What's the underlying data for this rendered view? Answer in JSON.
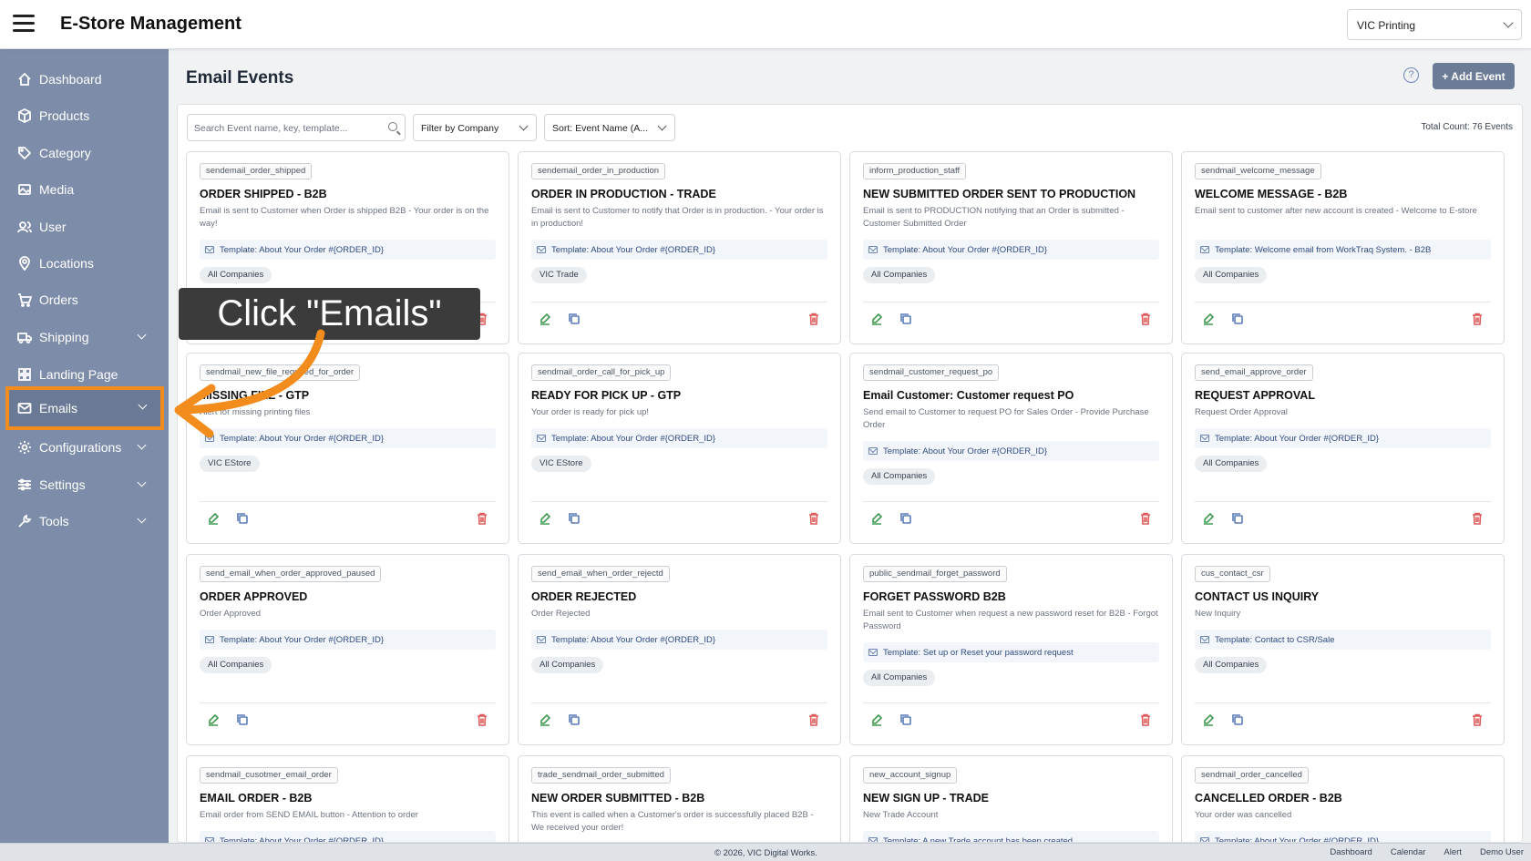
{
  "header": {
    "title": "E-Store Management",
    "company_value": "VIC Printing"
  },
  "sidebar": {
    "items": [
      {
        "label": "Dashboard",
        "icon": "home-icon"
      },
      {
        "label": "Products",
        "icon": "box-icon"
      },
      {
        "label": "Category",
        "icon": "tag-icon"
      },
      {
        "label": "Media",
        "icon": "image-icon"
      },
      {
        "label": "User",
        "icon": "users-icon"
      },
      {
        "label": "Locations",
        "icon": "map-pin-icon"
      },
      {
        "label": "Orders",
        "icon": "cart-icon"
      },
      {
        "label": "Shipping",
        "icon": "truck-icon"
      },
      {
        "label": "Landing Page",
        "icon": "layout-icon"
      },
      {
        "label": "Emails",
        "icon": "mail-icon"
      },
      {
        "label": "Configurations",
        "icon": "gear-icon"
      },
      {
        "label": "Settings",
        "icon": "sliders-icon"
      },
      {
        "label": "Tools",
        "icon": "wrench-icon"
      }
    ]
  },
  "main": {
    "title": "Email Events",
    "add_label": "+ Add Event",
    "search_placeholder": "Search Event name, key, template...",
    "filter_company": "Filter by Company",
    "sort_label": "Sort: Event Name (A...",
    "total_count": "Total Count: 76 Events"
  },
  "cards": [
    {
      "key": "sendemail_order_shipped",
      "title": "ORDER SHIPPED - B2B",
      "desc": "Email is sent to Customer when Order is shipped B2B - Your order is on the way!",
      "template": "Template: About Your Order #{ORDER_ID}",
      "company": "All Companies"
    },
    {
      "key": "sendemail_order_in_production",
      "title": "ORDER IN PRODUCTION - TRADE",
      "desc": "Email is sent to Customer to notify that Order is in production. - Your order is in production!",
      "template": "Template: About Your Order #{ORDER_ID}",
      "company": "VIC Trade"
    },
    {
      "key": "inform_production_staff",
      "title": "NEW SUBMITTED ORDER SENT TO PRODUCTION",
      "desc": "Email is sent to PRODUCTION notifying that an Order is submitted - Customer Submitted Order",
      "template": "Template: About Your Order #{ORDER_ID}",
      "company": "All Companies"
    },
    {
      "key": "sendmail_welcome_message",
      "title": "WELCOME MESSAGE - B2B",
      "desc": "Email sent to customer after new account is created - Welcome to E-store",
      "template": "Template: Welcome email from WorkTraq System. - B2B",
      "company": "All Companies"
    },
    {
      "key": "sendmail_new_file_required_for_order",
      "title": "MISSING FILE - GTP",
      "desc": "Alert for missing printing files",
      "template": "Template: About Your Order #{ORDER_ID}",
      "company": "VIC EStore"
    },
    {
      "key": "sendmail_order_call_for_pick_up",
      "title": "READY FOR PICK UP - GTP",
      "desc": "Your order is ready for pick up!",
      "template": "Template: About Your Order #{ORDER_ID}",
      "company": "VIC EStore"
    },
    {
      "key": "sendmail_customer_request_po",
      "title": "Email Customer: Customer request PO",
      "desc": "Send email to Customer to request PO for Sales Order - Provide Purchase Order",
      "template": "Template: About Your Order #{ORDER_ID}",
      "company": "All Companies"
    },
    {
      "key": "send_email_approve_order",
      "title": "REQUEST APPROVAL",
      "desc": "Request Order Approval",
      "template": "Template: About Your Order #{ORDER_ID}",
      "company": "All Companies"
    },
    {
      "key": "send_email_when_order_approved_paused",
      "title": "ORDER APPROVED",
      "desc": "Order Approved",
      "template": "Template: About Your Order #{ORDER_ID}",
      "company": "All Companies"
    },
    {
      "key": "send_email_when_order_rejectd",
      "title": "ORDER REJECTED",
      "desc": "Order Rejected",
      "template": "Template: About Your Order #{ORDER_ID}",
      "company": "All Companies"
    },
    {
      "key": "public_sendmail_forget_password",
      "title": "FORGET PASSWORD B2B",
      "desc": "Email sent to Customer when request a new password reset for B2B - Forgot Password",
      "template": "Template: Set up or Reset your password request",
      "company": "All Companies"
    },
    {
      "key": "cus_contact_csr",
      "title": "CONTACT US INQUIRY",
      "desc": "New Inquiry",
      "template": "Template: Contact to CSR/Sale",
      "company": "All Companies"
    },
    {
      "key": "sendmail_cusotmer_email_order",
      "title": "EMAIL ORDER - B2B",
      "desc": "Email order from SEND EMAIL button - Attention to order",
      "template": "Template: About Your Order #{ORDER_ID}",
      "company": ""
    },
    {
      "key": "trade_sendmail_order_submitted",
      "title": "NEW ORDER SUBMITTED - B2B",
      "desc": "This event is called when a Customer's order is successfully placed B2B - We received your order!",
      "template": "",
      "company": ""
    },
    {
      "key": "new_account_signup",
      "title": "NEW SIGN UP - TRADE",
      "desc": "New Trade Account",
      "template": "Template: A new Trade account has been created",
      "company": ""
    },
    {
      "key": "sendmail_order_cancelled",
      "title": "CANCELLED ORDER - B2B",
      "desc": "Your order was cancelled",
      "template": "Template: About Your Order #{ORDER_ID}",
      "company": ""
    }
  ],
  "footer": {
    "copyright": "© 2026, VIC Digital Works.",
    "links": [
      "Dashboard",
      "Calendar",
      "Alert",
      "Demo User"
    ]
  },
  "callout": {
    "text": "Click \"Emails\""
  },
  "colors": {
    "sidebar": "#7d8ca8",
    "accent": "#f28c1c",
    "delete": "#e05a5a",
    "edit": "#3f9a4f",
    "copy": "#5a7bb8"
  }
}
